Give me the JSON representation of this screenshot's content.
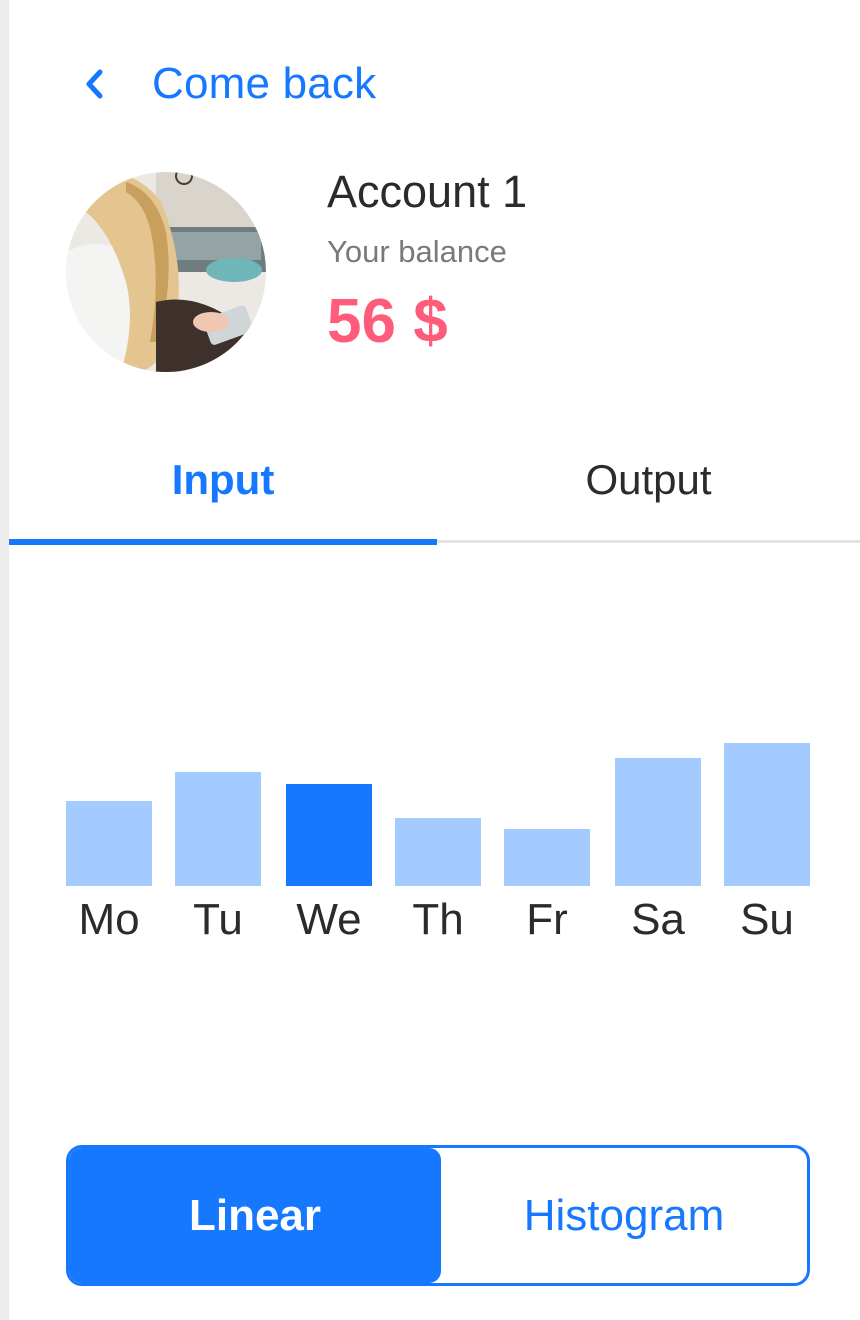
{
  "nav": {
    "back_label": "Come back",
    "back_icon": "chevron-left-icon"
  },
  "account": {
    "name": "Account 1",
    "balance_label": "Your balance",
    "balance_value": "56 $"
  },
  "tabs": [
    {
      "label": "Input",
      "active": true
    },
    {
      "label": "Output",
      "active": false
    }
  ],
  "chart_data": {
    "type": "bar",
    "categories": [
      "Mo",
      "Tu",
      "We",
      "Th",
      "Fr",
      "Sa",
      "Su"
    ],
    "values": [
      85,
      114,
      102,
      68,
      57,
      128,
      143
    ],
    "highlighted": "We",
    "colors": {
      "bar": "#a3cbff",
      "highlight": "#1677ff",
      "label": "#2b2b2b"
    }
  },
  "view_toggle": {
    "options": [
      "Linear",
      "Histogram"
    ],
    "selected": "Linear"
  },
  "colors": {
    "accent": "#1677ff",
    "balance": "#ff5c7c",
    "text": "#2b2b2b",
    "muted": "#7a7a7a"
  }
}
